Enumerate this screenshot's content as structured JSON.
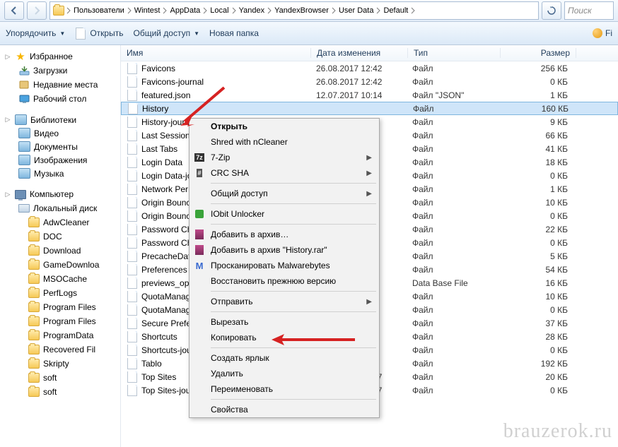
{
  "breadcrumbs": [
    "Пользователи",
    "Wintest",
    "AppData",
    "Local",
    "Yandex",
    "YandexBrowser",
    "User Data",
    "Default"
  ],
  "search_placeholder": "Поиск",
  "toolbar": {
    "organize": "Упорядочить",
    "open": "Открыть",
    "share": "Общий доступ",
    "newfolder": "Новая папка",
    "fi": "Fi"
  },
  "sidebar": {
    "favorites": "Избранное",
    "downloads": "Загрузки",
    "recent": "Недавние места",
    "desktop": "Рабочий стол",
    "libraries": "Библиотеки",
    "video": "Видео",
    "documents": "Документы",
    "images": "Изображения",
    "music": "Музыка",
    "computer": "Компьютер",
    "drive": "Локальный диск",
    "folders": [
      "AdwCleaner",
      "DOC",
      "Download",
      "GameDownloa",
      "MSOCache",
      "PerfLogs",
      "Program Files",
      "Program Files",
      "ProgramData",
      "Recovered Fil",
      "Skripty",
      "soft",
      "soft"
    ]
  },
  "columns": {
    "name": "Имя",
    "date": "Дата изменения",
    "type": "Тип",
    "size": "Размер"
  },
  "files": [
    {
      "name": "Favicons",
      "date": "26.08.2017 12:42",
      "type": "Файл",
      "size": "256 КБ"
    },
    {
      "name": "Favicons-journal",
      "date": "26.08.2017 12:42",
      "type": "Файл",
      "size": "0 КБ"
    },
    {
      "name": "featured.json",
      "date": "12.07.2017 10:14",
      "type": "Файл \"JSON\"",
      "size": "1 КБ"
    },
    {
      "name": "History",
      "date": "",
      "type": "Файл",
      "size": "160 КБ",
      "selected": true
    },
    {
      "name": "History-journ",
      "date": "",
      "type": "Файл",
      "size": "9 КБ"
    },
    {
      "name": "Last Session",
      "date": "",
      "type": "Файл",
      "size": "66 КБ"
    },
    {
      "name": "Last Tabs",
      "date": "",
      "type": "Файл",
      "size": "41 КБ"
    },
    {
      "name": "Login Data",
      "date": "",
      "type": "Файл",
      "size": "18 КБ"
    },
    {
      "name": "Login Data-jo",
      "date": "",
      "type": "Файл",
      "size": "0 КБ"
    },
    {
      "name": "Network Per",
      "date": "",
      "type": "Файл",
      "size": "1 КБ"
    },
    {
      "name": "Origin Bounc",
      "date": "",
      "type": "Файл",
      "size": "10 КБ"
    },
    {
      "name": "Origin Bounc",
      "date": "",
      "type": "Файл",
      "size": "0 КБ"
    },
    {
      "name": "Password Ch",
      "date": "",
      "type": "Файл",
      "size": "22 КБ"
    },
    {
      "name": "Password Ch",
      "date": "",
      "type": "Файл",
      "size": "0 КБ"
    },
    {
      "name": "PrecacheDat",
      "date": "",
      "type": "Файл",
      "size": "5 КБ"
    },
    {
      "name": "Preferences",
      "date": "",
      "type": "Файл",
      "size": "54 КБ"
    },
    {
      "name": "previews_opt",
      "date": "",
      "type": "Data Base File",
      "size": "16 КБ"
    },
    {
      "name": "QuotaManag",
      "date": "",
      "type": "Файл",
      "size": "10 КБ"
    },
    {
      "name": "QuotaManag",
      "date": "",
      "type": "Файл",
      "size": "0 КБ"
    },
    {
      "name": "Secure Prefer",
      "date": "",
      "type": "Файл",
      "size": "37 КБ"
    },
    {
      "name": "Shortcuts",
      "date": "",
      "type": "Файл",
      "size": "28 КБ"
    },
    {
      "name": "Shortcuts-jou",
      "date": "",
      "type": "Файл",
      "size": "0 КБ"
    },
    {
      "name": "Tablo",
      "date": "",
      "type": "Файл",
      "size": "192 КБ"
    },
    {
      "name": "Top Sites",
      "date": "26.08.2017 12:27",
      "type": "Файл",
      "size": "20 КБ"
    },
    {
      "name": "Top Sites-journal",
      "date": "26.08.2017 12:27",
      "type": "Файл",
      "size": "0 КБ"
    }
  ],
  "context_menu": [
    {
      "label": "Открыть",
      "bold": true
    },
    {
      "label": "Shred with nCleaner"
    },
    {
      "label": "7-Zip",
      "icon": "7z",
      "sub": true
    },
    {
      "label": "CRC SHA",
      "icon": "crc",
      "sub": true
    },
    {
      "sep": true
    },
    {
      "label": "Общий доступ",
      "sub": true
    },
    {
      "sep": true
    },
    {
      "label": "IObit Unlocker",
      "icon": "unlock"
    },
    {
      "sep": true
    },
    {
      "label": "Добавить в архив…",
      "icon": "rar"
    },
    {
      "label": "Добавить в архив \"History.rar\"",
      "icon": "rar"
    },
    {
      "label": "Просканировать Malwarebytes",
      "icon": "mwb"
    },
    {
      "label": "Восстановить прежнюю версию"
    },
    {
      "sep": true
    },
    {
      "label": "Отправить",
      "sub": true
    },
    {
      "sep": true
    },
    {
      "label": "Вырезать"
    },
    {
      "label": "Копировать"
    },
    {
      "sep": true
    },
    {
      "label": "Создать ярлык"
    },
    {
      "label": "Удалить"
    },
    {
      "label": "Переименовать"
    },
    {
      "sep": true
    },
    {
      "label": "Свойства"
    }
  ],
  "watermark": "brauzerok.ru"
}
